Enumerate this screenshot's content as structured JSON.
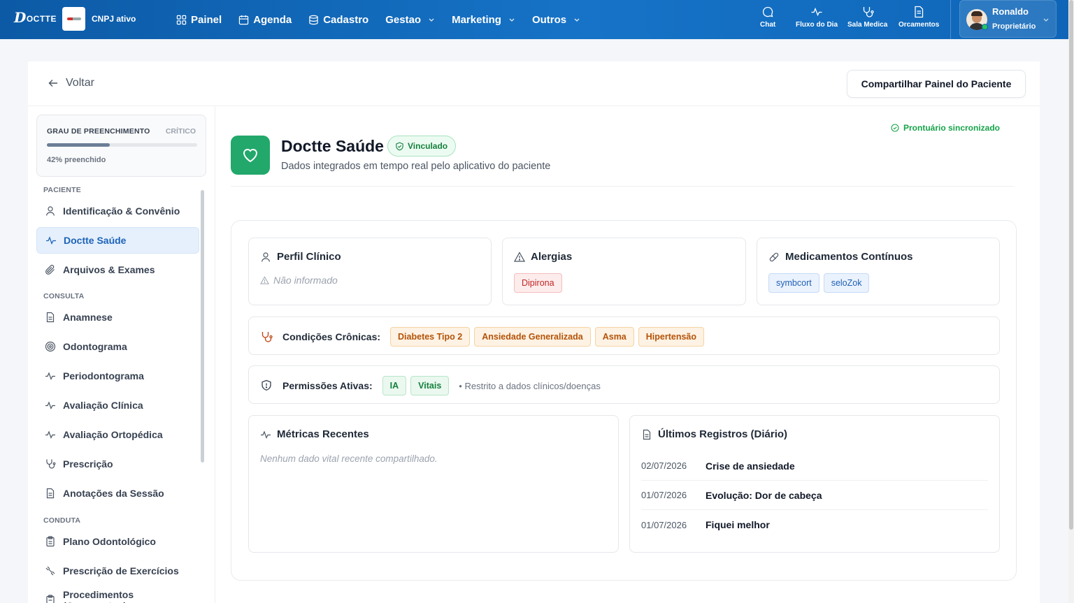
{
  "topbar": {
    "logo_text": "OCTTE",
    "cnpj_label": "CNPJ ativo",
    "nav": [
      {
        "label": "Painel",
        "icon": "grid-icon"
      },
      {
        "label": "Agenda",
        "icon": "calendar-icon"
      },
      {
        "label": "Cadastro",
        "icon": "database-icon"
      },
      {
        "label": "Gestao",
        "icon": "chevron-down-icon"
      },
      {
        "label": "Marketing",
        "icon": "chevron-down-icon"
      },
      {
        "label": "Outros",
        "icon": "chevron-down-icon"
      }
    ],
    "quick": [
      {
        "label": "Chat",
        "icon": "chat-icon"
      },
      {
        "label": "Fluxo do Dia",
        "icon": "activity-icon"
      },
      {
        "label": "Sala Medica",
        "icon": "stethoscope-icon"
      },
      {
        "label": "Orcamentos",
        "icon": "document-icon"
      }
    ],
    "user": {
      "name": "Ronaldo",
      "role": "Proprietário"
    }
  },
  "header": {
    "back_label": "Voltar",
    "share_label": "Compartilhar Painel do Paciente"
  },
  "sidebar": {
    "fill": {
      "title": "GRAU DE PREENCHIMENTO",
      "status": "CRÍTICO",
      "percent_label": "42% preenchido",
      "percent": 42
    },
    "sections": [
      "PACIENTE",
      "CONSULTA",
      "CONDUTA"
    ],
    "items": [
      "Identificação & Convênio",
      "Doctte Saúde",
      "Arquivos & Exames",
      "Anamnese",
      "Odontograma",
      "Periodontograma",
      "Avaliação Clínica",
      "Avaliação Ortopédica",
      "Prescrição",
      "Anotações da Sessão",
      "Plano Odontológico",
      "Prescrição de Exercícios",
      "Procedimentos (Orcamentos)"
    ],
    "active_item": "Doctte Saúde"
  },
  "content": {
    "sync_label": "Prontuário sincronizado",
    "app_title": "Doctte Saúde",
    "linked_label": "Vinculado",
    "app_subtitle": "Dados integrados em tempo real pelo aplicativo do paciente",
    "perfil": {
      "title": "Perfil Clínico",
      "value": "Não informado"
    },
    "alergias": {
      "title": "Alergias",
      "items": [
        "Dipirona"
      ]
    },
    "medicamentos": {
      "title": "Medicamentos Contínuos",
      "items": [
        "symbcort",
        "seloZok"
      ]
    },
    "condicoes": {
      "label": "Condições Crônicas:",
      "items": [
        "Diabetes Tipo 2",
        "Ansiedade Generalizada",
        "Asma",
        "Hipertensão"
      ]
    },
    "permissoes": {
      "label": "Permissões Ativas:",
      "items": [
        "IA",
        "Vitais"
      ],
      "note": "• Restrito a dados clínicos/doenças"
    },
    "metricas": {
      "title": "Métricas Recentes",
      "empty": "Nenhum dado vital recente compartilhado."
    },
    "registros": {
      "title": "Últimos Registros (Diário)",
      "rows": [
        {
          "date": "02/07/2026",
          "text": "Crise de ansiedade"
        },
        {
          "date": "01/07/2026",
          "text": "Evolução: Dor de cabeça"
        },
        {
          "date": "01/07/2026",
          "text": "Fiquei melhor"
        }
      ]
    }
  },
  "colors": {
    "topbar": "#1268b6",
    "accent_green": "#22a86b",
    "active_blue": "#1d63b8",
    "critical_bar": "#6b7f96"
  }
}
